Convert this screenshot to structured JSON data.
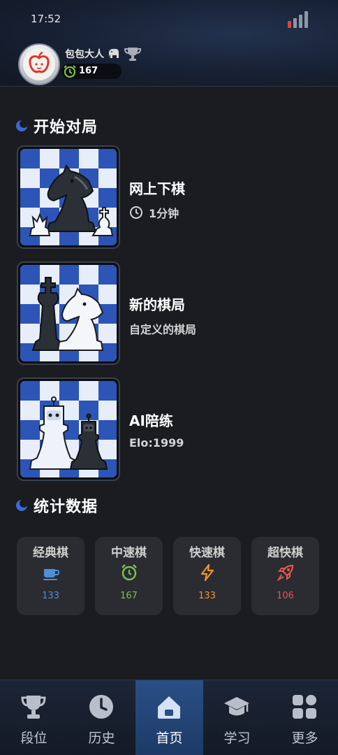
{
  "status_bar": {
    "time": "17:52"
  },
  "profile": {
    "username": "包包大人",
    "rating": "167"
  },
  "sections": {
    "start_game": "开始对局",
    "statistics": "统计数据"
  },
  "game_cards": [
    {
      "title": "网上下棋",
      "subtitle": "1分钟",
      "icon": "clock-icon"
    },
    {
      "title": "新的棋局",
      "subtitle": "自定义的棋局"
    },
    {
      "title": "AI陪练",
      "subtitle": "Elo:1999"
    }
  ],
  "stats": [
    {
      "label": "经典棋",
      "value": "133",
      "icon": "cup-icon",
      "color": "#4d90d6"
    },
    {
      "label": "中速棋",
      "value": "167",
      "icon": "alarm-clock-icon",
      "color": "#7cc04b"
    },
    {
      "label": "快速棋",
      "value": "133",
      "icon": "lightning-icon",
      "color": "#f0962e"
    },
    {
      "label": "超快棋",
      "value": "106",
      "icon": "rocket-icon",
      "color": "#e8574a"
    }
  ],
  "nav": [
    {
      "label": "段位",
      "icon": "trophy-icon"
    },
    {
      "label": "历史",
      "icon": "clock-icon"
    },
    {
      "label": "首页",
      "icon": "home-icon",
      "active": true
    },
    {
      "label": "学习",
      "icon": "graduation-cap-icon"
    },
    {
      "label": "更多",
      "icon": "grid-icon"
    }
  ],
  "colors": {
    "background": "#1b1c1f",
    "header": "#172033",
    "accent": "#3a6bd8",
    "board_blue": "#2d55b7",
    "board_light": "#e8eef9"
  }
}
